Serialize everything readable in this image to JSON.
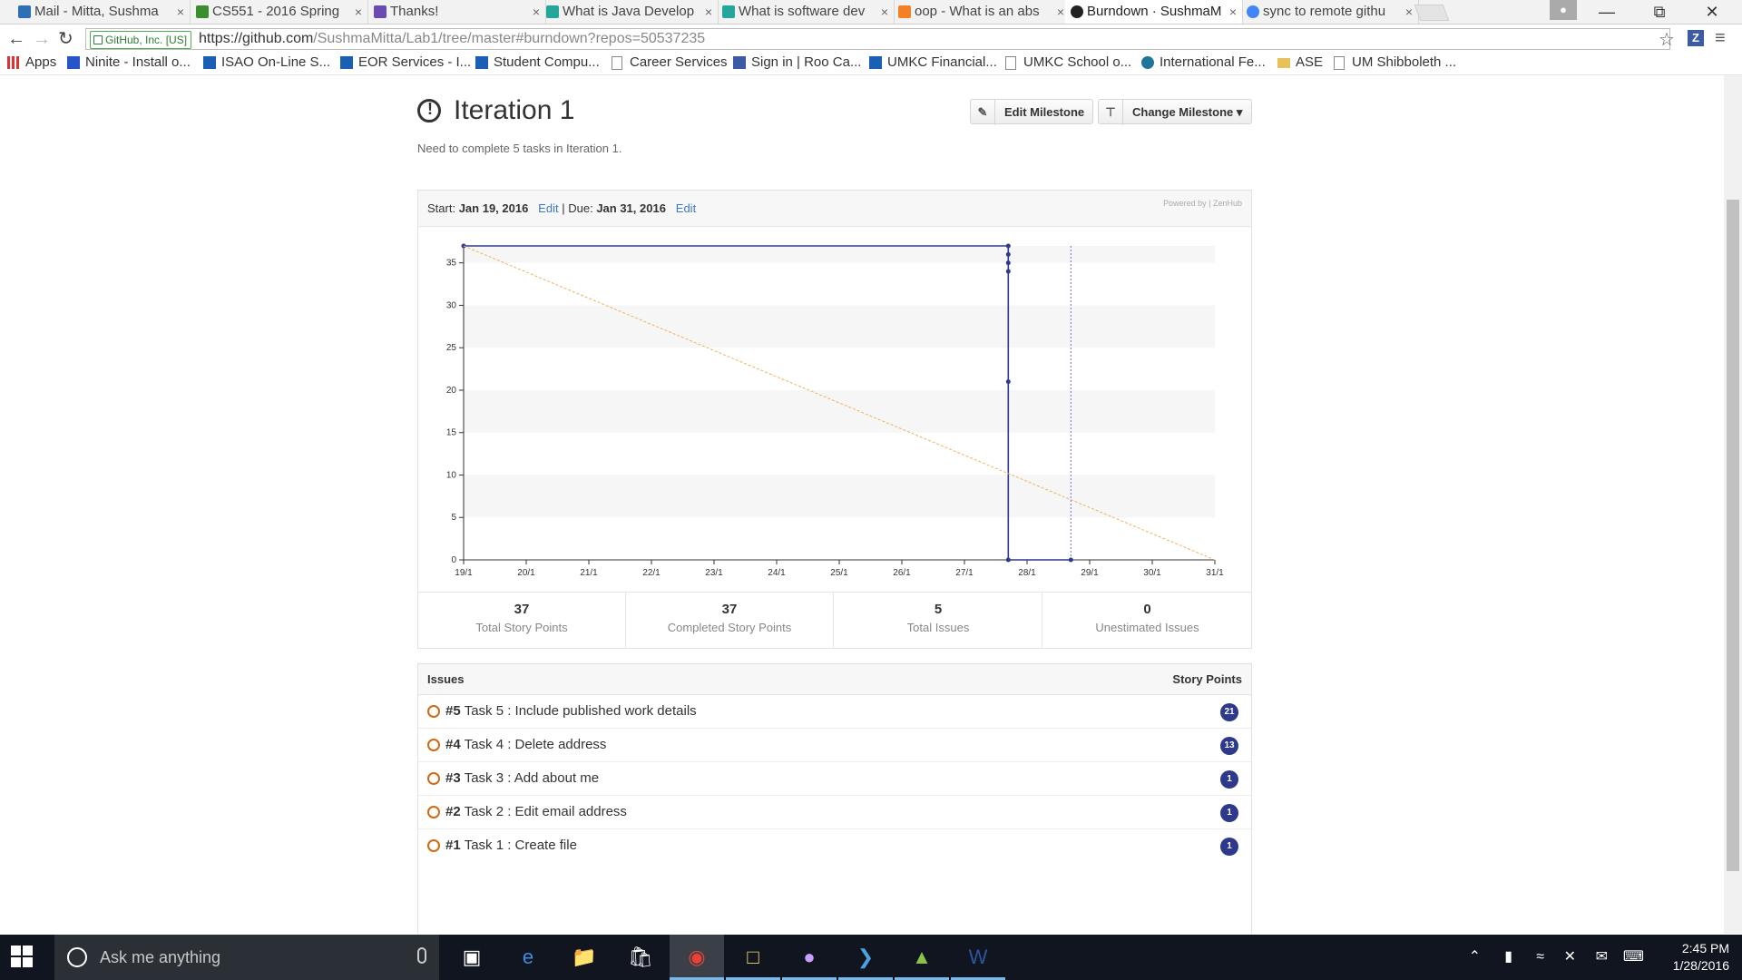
{
  "browser": {
    "tabs": [
      {
        "title": "Mail - Mitta, Sushma",
        "icon_color": "#2f6fb5"
      },
      {
        "title": "CS551 - 2016 Spring",
        "icon_color": "#3c8d2f"
      },
      {
        "title": "Thanks!",
        "icon_color": "#6a4bb0"
      },
      {
        "title": "What is Java Develop",
        "icon_color": "#26a69a"
      },
      {
        "title": "What is software dev",
        "icon_color": "#26a69a"
      },
      {
        "title": "oop - What is an abs",
        "icon_color": "#f48024"
      },
      {
        "title": "Burndown · SushmaM",
        "icon_color": "#222222"
      },
      {
        "title": "sync to remote githu",
        "icon_color": "#4285f4"
      }
    ],
    "close_glyph": "×",
    "secure_label": "GitHub, Inc. [US]",
    "url_host": "https://github.com",
    "url_path": "/SushmaMitta/Lab1/tree/master#burndown?repos=50537235",
    "bookmarks": [
      {
        "label": "Apps",
        "icon": "apps-grid-icon"
      },
      {
        "label": "Ninite - Install o...",
        "icon": "ninite-icon"
      },
      {
        "label": "ISAO On-Line S...",
        "icon": "umkc-flag-icon"
      },
      {
        "label": "EOR Services - I...",
        "icon": "umkc-flag-icon"
      },
      {
        "label": "Student Compu...",
        "icon": "umkc-flag-icon"
      },
      {
        "label": "Career Services",
        "icon": "page-icon"
      },
      {
        "label": "Sign in | Roo Ca...",
        "icon": "canvas-icon"
      },
      {
        "label": "UMKC Financial...",
        "icon": "umkc-flag-icon"
      },
      {
        "label": "UMKC School o...",
        "icon": "page-icon"
      },
      {
        "label": "International Fe...",
        "icon": "wordpress-icon"
      },
      {
        "label": "ASE",
        "icon": "folder-icon"
      },
      {
        "label": "UM Shibboleth ...",
        "icon": "page-icon"
      }
    ]
  },
  "milestone": {
    "title": "Iteration 1",
    "description": "Need to complete 5 tasks in Iteration 1.",
    "edit_button": "Edit Milestone",
    "change_button": "Change Milestone ▾",
    "start_label": "Start:",
    "start_date": "Jan 19, 2016",
    "due_label": "Due:",
    "due_date": "Jan 31, 2016",
    "edit_link": "Edit",
    "separator": "|",
    "powered_by": "Powered by | ZenHub"
  },
  "chart_data": {
    "type": "line",
    "x_categories": [
      "19/1",
      "20/1",
      "21/1",
      "22/1",
      "23/1",
      "24/1",
      "25/1",
      "26/1",
      "27/1",
      "28/1",
      "29/1",
      "30/1",
      "31/1"
    ],
    "y_ticks": [
      0,
      5,
      10,
      15,
      20,
      25,
      30,
      35
    ],
    "ylim": [
      0,
      37
    ],
    "grid": "horizontal bands",
    "series": [
      {
        "role": "actual-remaining",
        "color": "#2d3a8c",
        "points": [
          [
            0,
            37
          ],
          [
            8.7,
            37
          ],
          [
            8.7,
            36
          ],
          [
            8.7,
            35
          ],
          [
            8.7,
            34
          ],
          [
            8.7,
            21
          ],
          [
            8.7,
            0
          ],
          [
            9.7,
            0
          ]
        ]
      },
      {
        "role": "ideal",
        "color": "#f0b060",
        "dashed": true,
        "points": [
          [
            0,
            37
          ],
          [
            12,
            0
          ]
        ]
      }
    ],
    "today_marker": 9.7,
    "today_color": "#6a6adb"
  },
  "stats": [
    {
      "value": "37",
      "label": "Total Story Points"
    },
    {
      "value": "37",
      "label": "Completed Story Points"
    },
    {
      "value": "5",
      "label": "Total Issues"
    },
    {
      "value": "0",
      "label": "Unestimated Issues"
    }
  ],
  "issues": {
    "header": "Issues",
    "points_header": "Story Points",
    "rows": [
      {
        "number": "#5",
        "title": "Task 5 : Include published work details",
        "points": "21"
      },
      {
        "number": "#4",
        "title": "Task 4 : Delete address",
        "points": "13"
      },
      {
        "number": "#3",
        "title": "Task 3 : Add about me",
        "points": "1"
      },
      {
        "number": "#2",
        "title": "Task 2 : Edit email address",
        "points": "1"
      },
      {
        "number": "#1",
        "title": "Task 1 : Create file",
        "points": "1"
      }
    ]
  },
  "taskbar": {
    "search_placeholder": "Ask me anything",
    "time": "2:45 PM",
    "date": "1/28/2016"
  }
}
